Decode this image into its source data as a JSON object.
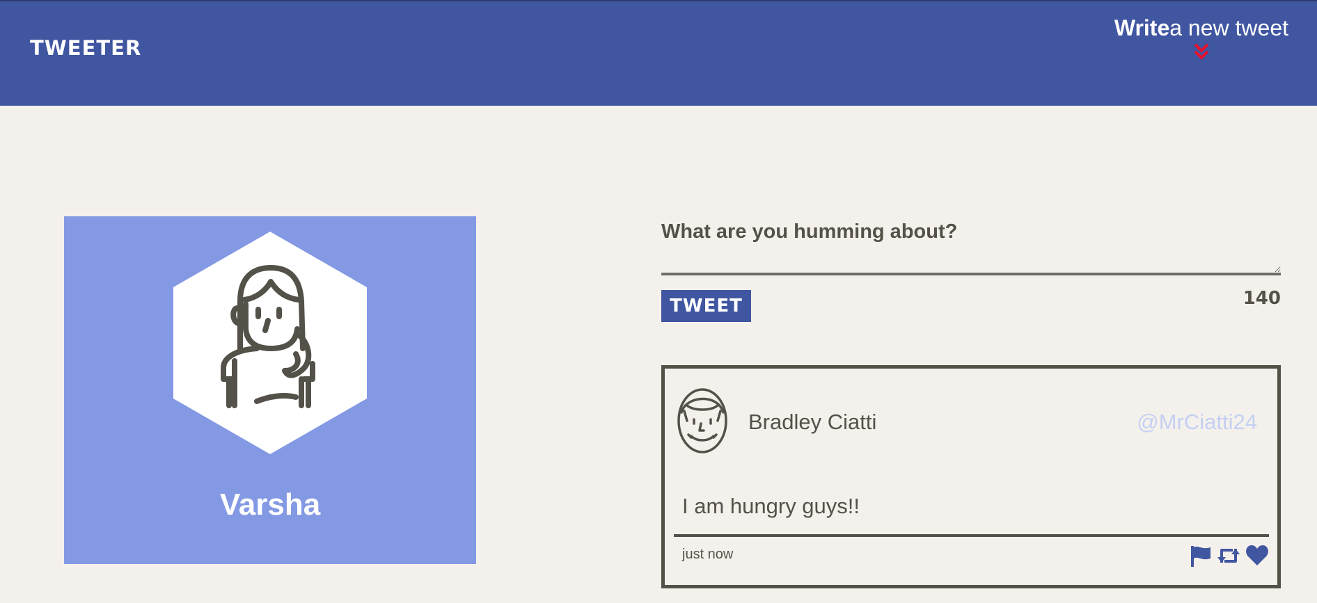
{
  "navbar": {
    "brand": "TWEETER",
    "compose_bold": "Write",
    "compose_rest": "a new tweet"
  },
  "profile": {
    "name": "Varsha"
  },
  "composer": {
    "placeholder": "What are you humming about?",
    "button_label": "TWEET",
    "counter": "140"
  },
  "tweet": {
    "author_name": "Bradley Ciatti",
    "handle": "@MrCiatti24",
    "text": "I am hungry guys!!",
    "timestamp": "just now",
    "actions": [
      "flag-icon",
      "retweet-icon",
      "heart-icon"
    ]
  },
  "colors": {
    "header_bg": "#4056a1",
    "page_bg": "#f4f1ec",
    "profile_bg": "#8499e4",
    "text_dark": "#545149",
    "handle_color": "#c5cff3",
    "chevron_red": "#e8112d"
  }
}
